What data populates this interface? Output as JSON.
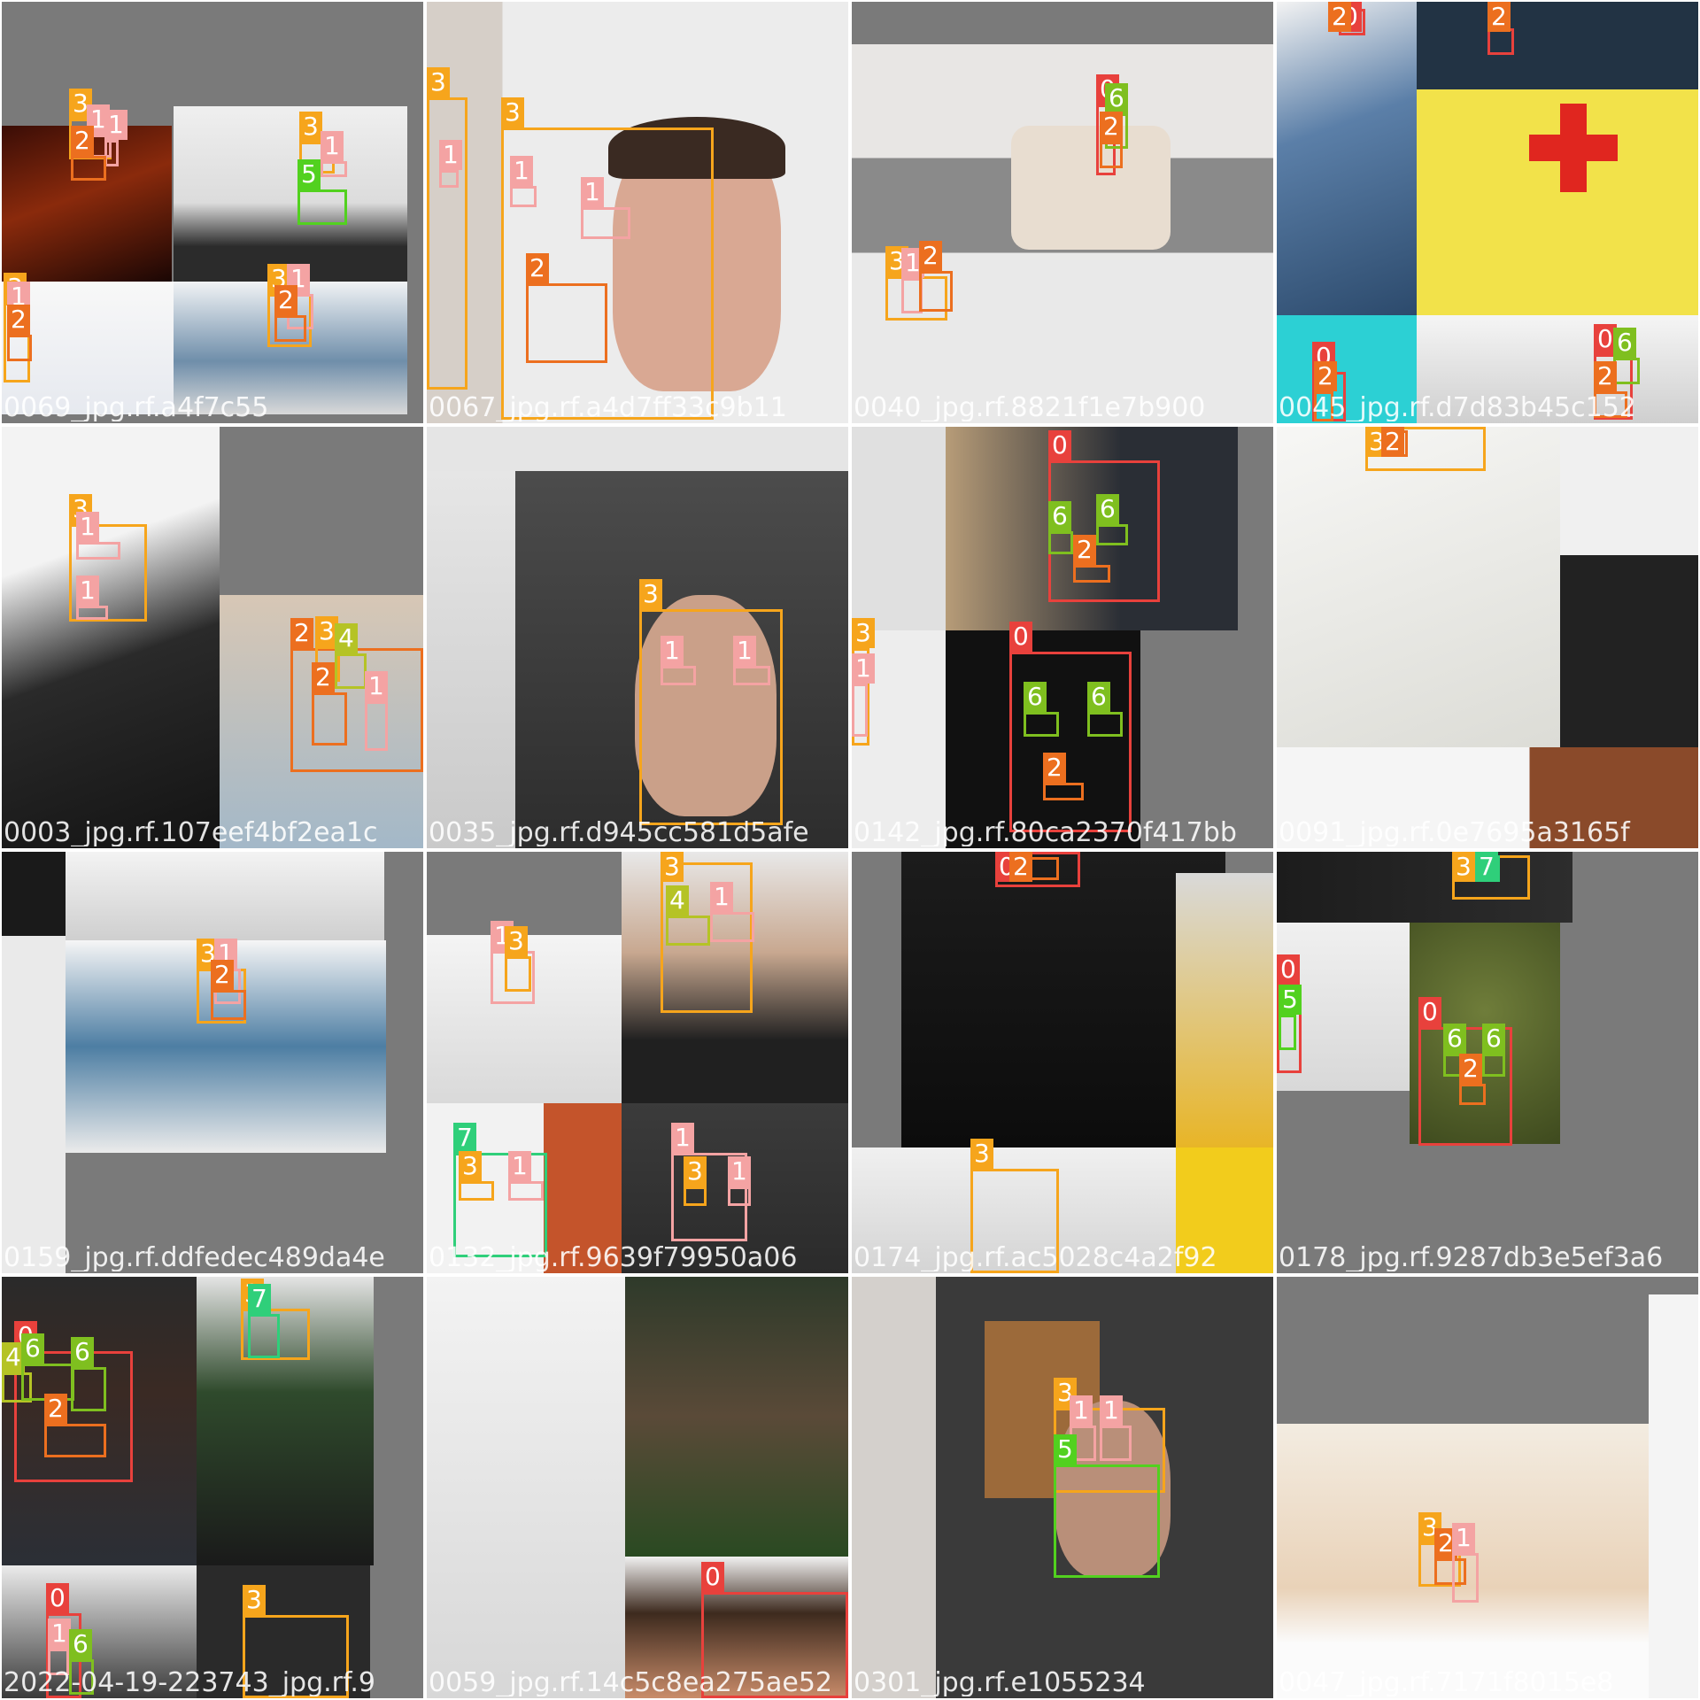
{
  "class_colors": {
    "0": "#e8413c",
    "1": "#f4a3a3",
    "2": "#ec6f1f",
    "3": "#f6a51c",
    "4": "#b5c325",
    "5": "#52d11f",
    "6": "#7fbf1f",
    "7": "#2fcf7a"
  },
  "tiles": [
    {
      "caption": "0069_jpg.rf.a4f7c55",
      "boxes": [
        {
          "cls": "3",
          "label": "3"
        },
        {
          "cls": "1",
          "label": "1"
        },
        {
          "cls": "1",
          "label": "1"
        },
        {
          "cls": "2",
          "label": "2"
        },
        {
          "cls": "3",
          "label": "3"
        },
        {
          "cls": "5",
          "label": "5"
        },
        {
          "cls": "1",
          "label": "1"
        },
        {
          "cls": "3",
          "label": "3"
        },
        {
          "cls": "1",
          "label": "1"
        },
        {
          "cls": "2",
          "label": "2"
        },
        {
          "cls": "3",
          "label": "3"
        },
        {
          "cls": "1",
          "label": "1"
        },
        {
          "cls": "2",
          "label": "2"
        }
      ]
    },
    {
      "caption": "0067_jpg.rf.a4d7ff33c9b11",
      "boxes": [
        {
          "cls": "3",
          "label": "3"
        },
        {
          "cls": "1",
          "label": "1"
        },
        {
          "cls": "3",
          "label": "3"
        },
        {
          "cls": "1",
          "label": "1"
        },
        {
          "cls": "1",
          "label": "1"
        },
        {
          "cls": "2",
          "label": "2"
        }
      ]
    },
    {
      "caption": "0040_jpg.rf.8821f1e7b900",
      "boxes": [
        {
          "cls": "0",
          "label": "0"
        },
        {
          "cls": "6",
          "label": "6"
        },
        {
          "cls": "2",
          "label": "2"
        },
        {
          "cls": "3",
          "label": "3"
        },
        {
          "cls": "1",
          "label": "1"
        },
        {
          "cls": "2",
          "label": "2"
        }
      ]
    },
    {
      "caption": "0045_jpg.rf.d7d83b45c152",
      "boxes": [
        {
          "cls": "0",
          "label": "0"
        },
        {
          "cls": "2",
          "label": "2"
        },
        {
          "cls": "0",
          "label": "0"
        },
        {
          "cls": "2",
          "label": "2"
        },
        {
          "cls": "0",
          "label": "0"
        },
        {
          "cls": "2",
          "label": "2"
        },
        {
          "cls": "0",
          "label": "0"
        },
        {
          "cls": "6",
          "label": "6"
        },
        {
          "cls": "2",
          "label": "2"
        }
      ]
    },
    {
      "caption": "0003_jpg.rf.107eef4bf2ea1c",
      "boxes": [
        {
          "cls": "3",
          "label": "3"
        },
        {
          "cls": "1",
          "label": "1"
        },
        {
          "cls": "1",
          "label": "1"
        },
        {
          "cls": "2",
          "label": "2"
        },
        {
          "cls": "3",
          "label": "3"
        },
        {
          "cls": "4",
          "label": "4"
        },
        {
          "cls": "1",
          "label": "1"
        },
        {
          "cls": "2",
          "label": "2"
        }
      ]
    },
    {
      "caption": "0035_jpg.rf.d945cc581d5afe",
      "boxes": [
        {
          "cls": "3",
          "label": "3"
        },
        {
          "cls": "1",
          "label": "1"
        },
        {
          "cls": "1",
          "label": "1"
        }
      ]
    },
    {
      "caption": "0142_jpg.rf.80ca2370f417bb",
      "boxes": [
        {
          "cls": "0",
          "label": "0"
        },
        {
          "cls": "6",
          "label": "6"
        },
        {
          "cls": "6",
          "label": "6"
        },
        {
          "cls": "2",
          "label": "2"
        },
        {
          "cls": "0",
          "label": "0"
        },
        {
          "cls": "6",
          "label": "6"
        },
        {
          "cls": "6",
          "label": "6"
        },
        {
          "cls": "2",
          "label": "2"
        },
        {
          "cls": "3",
          "label": "3"
        },
        {
          "cls": "1",
          "label": "1"
        }
      ]
    },
    {
      "caption": "0091_jpg.rf.0e7695a3165f",
      "boxes": [
        {
          "cls": "3",
          "label": "3"
        },
        {
          "cls": "2",
          "label": "2"
        }
      ]
    },
    {
      "caption": "0159_jpg.rf.ddfedec489da4e",
      "boxes": [
        {
          "cls": "3",
          "label": "3"
        },
        {
          "cls": "1",
          "label": "1"
        },
        {
          "cls": "2",
          "label": "2"
        }
      ]
    },
    {
      "caption": "0132_jpg.rf.9639f79950a06",
      "boxes": [
        {
          "cls": "3",
          "label": "3"
        },
        {
          "cls": "4",
          "label": "4"
        },
        {
          "cls": "1",
          "label": "1"
        },
        {
          "cls": "1",
          "label": "1"
        },
        {
          "cls": "3",
          "label": "3"
        },
        {
          "cls": "7",
          "label": "7"
        },
        {
          "cls": "3",
          "label": "3"
        },
        {
          "cls": "1",
          "label": "1"
        },
        {
          "cls": "1",
          "label": "1"
        },
        {
          "cls": "3",
          "label": "3"
        },
        {
          "cls": "1",
          "label": "1"
        },
        {
          "cls": "1",
          "label": "1"
        }
      ]
    },
    {
      "caption": "0174_jpg.rf.ac5028c4a2f92",
      "boxes": [
        {
          "cls": "0",
          "label": "0"
        },
        {
          "cls": "2",
          "label": "2"
        },
        {
          "cls": "3",
          "label": "3"
        }
      ]
    },
    {
      "caption": "0178_jpg.rf.9287db3e5ef3a6",
      "boxes": [
        {
          "cls": "3",
          "label": "3"
        },
        {
          "cls": "7",
          "label": "7"
        },
        {
          "cls": "0",
          "label": "0"
        },
        {
          "cls": "5",
          "label": "5"
        },
        {
          "cls": "0",
          "label": "0"
        },
        {
          "cls": "6",
          "label": "6"
        },
        {
          "cls": "6",
          "label": "6"
        },
        {
          "cls": "2",
          "label": "2"
        }
      ]
    },
    {
      "caption": "2022-04-19-223743_jpg.rf.9",
      "boxes": [
        {
          "cls": "0",
          "label": "0"
        },
        {
          "cls": "4",
          "label": "4"
        },
        {
          "cls": "6",
          "label": "6"
        },
        {
          "cls": "6",
          "label": "6"
        },
        {
          "cls": "2",
          "label": "2"
        },
        {
          "cls": "3",
          "label": "3"
        },
        {
          "cls": "7",
          "label": "7"
        },
        {
          "cls": "0",
          "label": "0"
        },
        {
          "cls": "1",
          "label": "1"
        },
        {
          "cls": "6",
          "label": "6"
        },
        {
          "cls": "3",
          "label": "3"
        }
      ]
    },
    {
      "caption": "0059_jpg.rf.14c5c8ea275ae52",
      "boxes": [
        {
          "cls": "0",
          "label": "0"
        }
      ]
    },
    {
      "caption": "0301_jpg.rf.e1055234",
      "boxes": [
        {
          "cls": "3",
          "label": "3"
        },
        {
          "cls": "1",
          "label": "1"
        },
        {
          "cls": "1",
          "label": "1"
        },
        {
          "cls": "5",
          "label": "5"
        }
      ]
    },
    {
      "caption": "0047_jpg.rf.7171f8015e8",
      "boxes": [
        {
          "cls": "3",
          "label": "3"
        },
        {
          "cls": "2",
          "label": "2"
        },
        {
          "cls": "1",
          "label": "1"
        }
      ]
    }
  ]
}
